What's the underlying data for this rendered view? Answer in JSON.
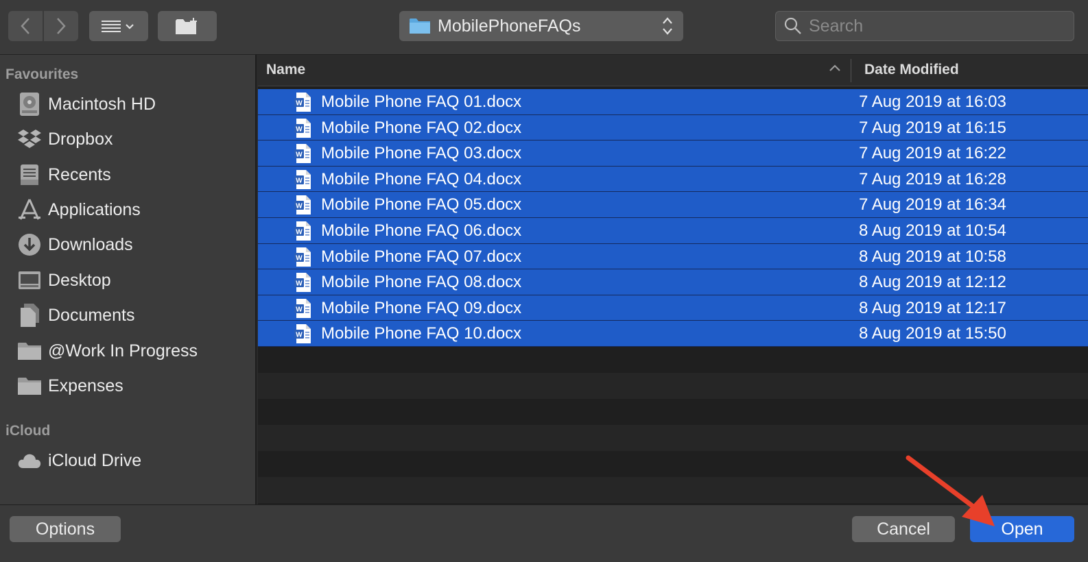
{
  "toolbar": {
    "back_icon": "chevron-left-icon",
    "forward_icon": "chevron-right-icon",
    "view_icon": "list-view-icon",
    "new_folder_icon": "new-folder-icon",
    "path": "MobilePhoneFAQs",
    "search_placeholder": "Search"
  },
  "sidebar": {
    "favourites_title": "Favourites",
    "favourites": [
      {
        "label": "Macintosh HD",
        "icon": "hard-drive-icon"
      },
      {
        "label": "Dropbox",
        "icon": "dropbox-icon"
      },
      {
        "label": "Recents",
        "icon": "recents-icon"
      },
      {
        "label": "Applications",
        "icon": "applications-icon"
      },
      {
        "label": "Downloads",
        "icon": "downloads-icon"
      },
      {
        "label": "Desktop",
        "icon": "desktop-icon"
      },
      {
        "label": "Documents",
        "icon": "documents-icon"
      },
      {
        "label": "@Work In Progress",
        "icon": "folder-icon"
      },
      {
        "label": "Expenses",
        "icon": "folder-icon"
      }
    ],
    "icloud_title": "iCloud",
    "icloud": [
      {
        "label": "iCloud Drive",
        "icon": "cloud-icon"
      }
    ]
  },
  "list": {
    "col_name": "Name",
    "col_date": "Date Modified",
    "files": [
      {
        "name": "Mobile Phone FAQ 01.docx",
        "date": "7 Aug 2019 at 16:03"
      },
      {
        "name": "Mobile Phone FAQ 02.docx",
        "date": "7 Aug 2019 at 16:15"
      },
      {
        "name": "Mobile Phone FAQ 03.docx",
        "date": "7 Aug 2019 at 16:22"
      },
      {
        "name": "Mobile Phone FAQ 04.docx",
        "date": "7 Aug 2019 at 16:28"
      },
      {
        "name": "Mobile Phone FAQ 05.docx",
        "date": "7 Aug 2019 at 16:34"
      },
      {
        "name": "Mobile Phone FAQ 06.docx",
        "date": "8 Aug 2019 at 10:54"
      },
      {
        "name": "Mobile Phone FAQ 07.docx",
        "date": "8 Aug 2019 at 10:58"
      },
      {
        "name": "Mobile Phone FAQ 08.docx",
        "date": "8 Aug 2019 at 12:12"
      },
      {
        "name": "Mobile Phone FAQ 09.docx",
        "date": "8 Aug 2019 at 12:17"
      },
      {
        "name": "Mobile Phone FAQ 10.docx",
        "date": "8 Aug 2019 at 15:50"
      }
    ]
  },
  "footer": {
    "options_label": "Options",
    "cancel_label": "Cancel",
    "open_label": "Open"
  },
  "colors": {
    "selection": "#1f5cc8",
    "primary_button": "#2768d8",
    "annotation_arrow": "#e8402a"
  }
}
